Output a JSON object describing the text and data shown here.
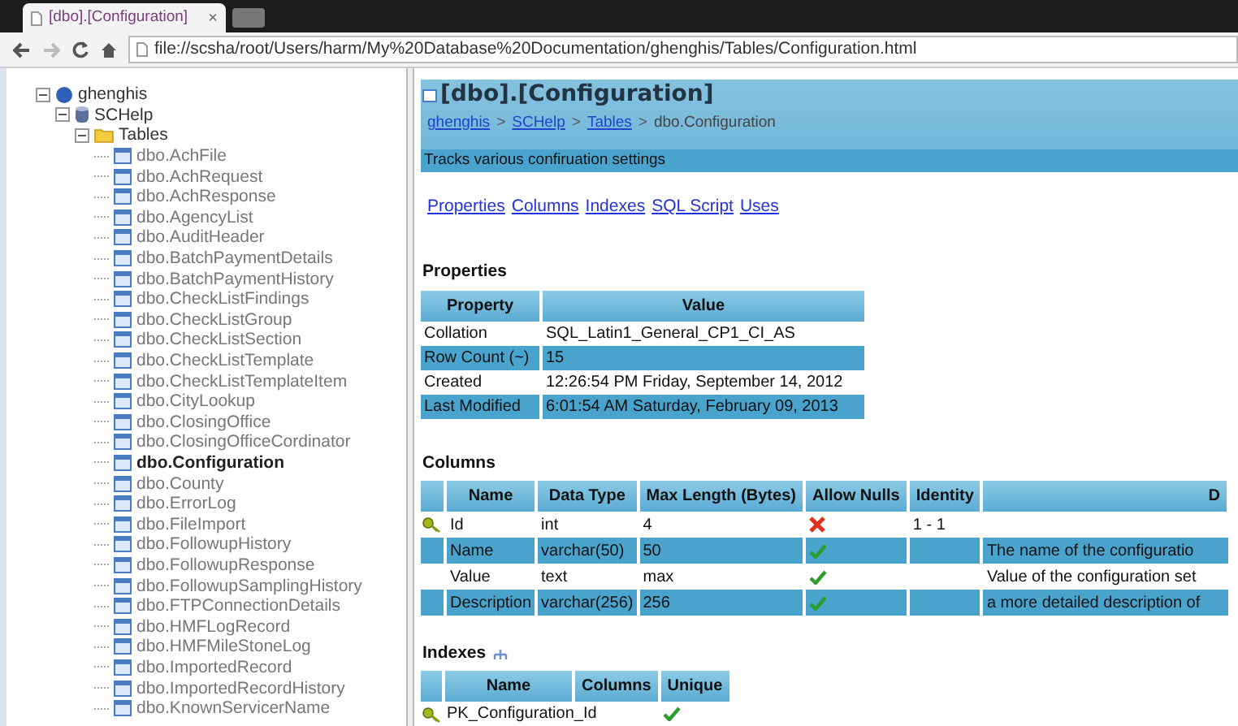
{
  "window": {
    "tab_title": "[dbo].[Configuration]",
    "close": "×"
  },
  "address_bar": {
    "value": "file://scsha/root/Users/harm/My%20Database%20Documentation/ghenghis/Tables/Configuration.html"
  },
  "tree": [
    {
      "label": "ghenghis",
      "kind": "server",
      "expanded": true,
      "selected": false,
      "children": [
        {
          "label": "SCHelp",
          "kind": "database",
          "expanded": true,
          "selected": false,
          "children": [
            {
              "label": "Tables",
              "kind": "folder",
              "expanded": true,
              "selected": false,
              "children": [
                {
                  "label": "dbo.AchFile",
                  "kind": "table",
                  "selected": false
                },
                {
                  "label": "dbo.AchRequest",
                  "kind": "table",
                  "selected": false
                },
                {
                  "label": "dbo.AchResponse",
                  "kind": "table",
                  "selected": false
                },
                {
                  "label": "dbo.AgencyList",
                  "kind": "table",
                  "selected": false
                },
                {
                  "label": "dbo.AuditHeader",
                  "kind": "table",
                  "selected": false
                },
                {
                  "label": "dbo.BatchPaymentDetails",
                  "kind": "table",
                  "selected": false
                },
                {
                  "label": "dbo.BatchPaymentHistory",
                  "kind": "table",
                  "selected": false
                },
                {
                  "label": "dbo.CheckListFindings",
                  "kind": "table",
                  "selected": false
                },
                {
                  "label": "dbo.CheckListGroup",
                  "kind": "table",
                  "selected": false
                },
                {
                  "label": "dbo.CheckListSection",
                  "kind": "table",
                  "selected": false
                },
                {
                  "label": "dbo.CheckListTemplate",
                  "kind": "table",
                  "selected": false
                },
                {
                  "label": "dbo.CheckListTemplateItem",
                  "kind": "table",
                  "selected": false
                },
                {
                  "label": "dbo.CityLookup",
                  "kind": "table",
                  "selected": false
                },
                {
                  "label": "dbo.ClosingOffice",
                  "kind": "table",
                  "selected": false
                },
                {
                  "label": "dbo.ClosingOfficeCordinator",
                  "kind": "table",
                  "selected": false
                },
                {
                  "label": "dbo.Configuration",
                  "kind": "table",
                  "selected": true
                },
                {
                  "label": "dbo.County",
                  "kind": "table",
                  "selected": false
                },
                {
                  "label": "dbo.ErrorLog",
                  "kind": "table",
                  "selected": false
                },
                {
                  "label": "dbo.FileImport",
                  "kind": "table",
                  "selected": false
                },
                {
                  "label": "dbo.FollowupHistory",
                  "kind": "table",
                  "selected": false
                },
                {
                  "label": "dbo.FollowupResponse",
                  "kind": "table",
                  "selected": false
                },
                {
                  "label": "dbo.FollowupSamplingHistory",
                  "kind": "table",
                  "selected": false
                },
                {
                  "label": "dbo.FTPConnectionDetails",
                  "kind": "table",
                  "selected": false
                },
                {
                  "label": "dbo.HMFLogRecord",
                  "kind": "table",
                  "selected": false
                },
                {
                  "label": "dbo.HMFMileStoneLog",
                  "kind": "table",
                  "selected": false
                },
                {
                  "label": "dbo.ImportedRecord",
                  "kind": "table",
                  "selected": false
                },
                {
                  "label": "dbo.ImportedRecordHistory",
                  "kind": "table",
                  "selected": false
                },
                {
                  "label": "dbo.KnownServicerName",
                  "kind": "table",
                  "selected": false
                }
              ]
            }
          ]
        }
      ]
    }
  ],
  "page": {
    "title": "[dbo].[Configuration]",
    "breadcrumb": [
      {
        "label": "ghenghis",
        "kind": "link"
      },
      {
        "label": "SCHelp",
        "kind": "link"
      },
      {
        "label": "Tables",
        "kind": "link"
      },
      {
        "label": "dbo.Configuration",
        "kind": "current"
      }
    ],
    "breadcrumb_separator": ">",
    "description": "Tracks various confiruation settings",
    "nav_links": [
      "Properties",
      "Columns",
      "Indexes",
      "SQL Script",
      "Uses"
    ],
    "properties": {
      "heading": "Properties",
      "headers": [
        "Property",
        "Value"
      ],
      "rows": [
        [
          "Collation",
          "SQL_Latin1_General_CP1_CI_AS"
        ],
        [
          "Row Count (~)",
          "15"
        ],
        [
          "Created",
          "12:26:54 PM Friday, September 14, 2012"
        ],
        [
          "Last Modified",
          "6:01:54 AM Saturday, February 09, 2013"
        ]
      ]
    },
    "columns": {
      "heading": "Columns",
      "headers": [
        "Name",
        "Data Type",
        "Max Length (Bytes)",
        "Allow Nulls",
        "Identity",
        "D"
      ],
      "rows": [
        {
          "primary_key": true,
          "name": "Id",
          "data_type": "int",
          "max_length": "4",
          "allow_nulls": false,
          "identity": "1 - 1"
        },
        {
          "primary_key": false,
          "name": "Name",
          "data_type": "varchar(50)",
          "max_length": "50",
          "allow_nulls": true,
          "description": "The name of the configuratio"
        },
        {
          "primary_key": false,
          "name": "Value",
          "data_type": "text",
          "max_length": "max",
          "allow_nulls": true,
          "description": "Value of the configuration set"
        },
        {
          "primary_key": false,
          "name": "Description",
          "data_type": "varchar(256)",
          "max_length": "256",
          "allow_nulls": true,
          "description": "a more detailed description of"
        }
      ]
    },
    "indexes": {
      "heading": "Indexes",
      "headers": [
        "Name",
        "Columns",
        "Unique"
      ],
      "rows": [
        {
          "primary_key": true,
          "name": "PK_Configuration_Id",
          "unique": true
        }
      ]
    }
  }
}
